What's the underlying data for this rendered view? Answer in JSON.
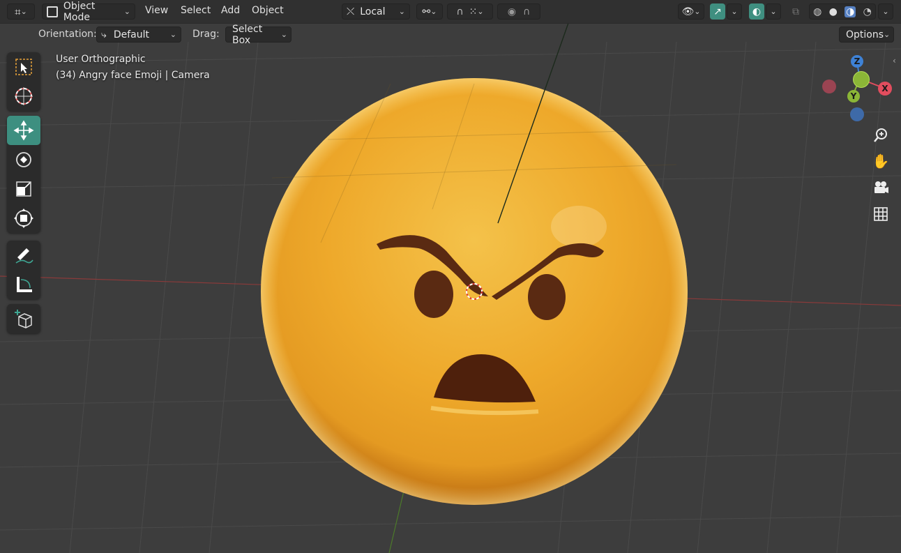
{
  "header": {
    "editor_type_icon": "grid-axes-icon",
    "mode_label": "Object Mode",
    "menus": [
      "View",
      "Select",
      "Add",
      "Object"
    ],
    "transform_orientation_label": "Local",
    "pivot_icon": "link-rings-icon",
    "snap_icon": "magnet-icon",
    "snap_target_icon": "grid-dots-icon",
    "proportional_icon": "circle-dot-icon",
    "falloff_icon": "falloff-curve-icon",
    "visibility_icon": "eye-icon",
    "gizmo_icon": "gizmo-arrow-icon",
    "overlay_icon": "overlay-circles-icon",
    "xray_icon": "xray-icon",
    "shading_modes": [
      "wireframe-icon",
      "solid-icon",
      "material-preview-icon",
      "rendered-icon"
    ],
    "active_shading_index": 2
  },
  "subheader": {
    "orientation_label": "Orientation:",
    "orientation_value": "Default",
    "drag_label": "Drag:",
    "drag_value": "Select Box",
    "options_label": "Options"
  },
  "viewport": {
    "view_name": "User Orthographic",
    "object_info": "(34) Angry face Emoji | Camera",
    "background_color": "#3d3d3d",
    "grid_color": "#4a4a4a"
  },
  "toolbar": {
    "tools": [
      {
        "name": "select-box-tool",
        "icon": "select-box-icon",
        "active": false
      },
      {
        "name": "cursor-tool",
        "icon": "cursor-crosshair-icon",
        "active": false
      },
      {
        "name": "move-tool",
        "icon": "move-arrows-icon",
        "active": true
      },
      {
        "name": "rotate-tool",
        "icon": "rotate-icon",
        "active": false
      },
      {
        "name": "scale-tool",
        "icon": "scale-icon",
        "active": false
      },
      {
        "name": "transform-tool",
        "icon": "transform-icon",
        "active": false
      },
      {
        "name": "annotate-tool",
        "icon": "annotate-pen-icon",
        "active": false
      },
      {
        "name": "measure-tool",
        "icon": "measure-ruler-icon",
        "active": false
      },
      {
        "name": "add-cube-tool",
        "icon": "add-cube-icon",
        "active": false
      }
    ]
  },
  "nav_gizmo": {
    "axes": [
      "X",
      "Y",
      "Z"
    ],
    "x_color": "#e24d5e",
    "y_color": "#8bb637",
    "z_color": "#3e82d6"
  },
  "nav_buttons": [
    "zoom-icon",
    "hand-pan-icon",
    "camera-icon",
    "grid-ortho-icon"
  ],
  "colors": {
    "accent": "#3f8f80",
    "emoji_yellow": "#f2b52f",
    "emoji_brown": "#5a2a12"
  }
}
